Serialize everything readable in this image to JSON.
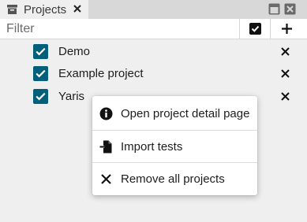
{
  "tab": {
    "icon": "archive-box-icon",
    "label": "Projects",
    "close_icon": "close-icon"
  },
  "window_controls": {
    "restore_icon": "window-restore-icon",
    "close_icon": "window-close-icon"
  },
  "toolbar": {
    "filter_value": "",
    "filter_placeholder": "Filter",
    "select_all_icon": "checkbox-checked-icon",
    "add_icon": "plus-icon"
  },
  "projects": [
    {
      "label": "Demo",
      "checked": true
    },
    {
      "label": "Example project",
      "checked": true
    },
    {
      "label": "Yaris",
      "checked": true
    }
  ],
  "context_menu": {
    "items": [
      {
        "label": "Open project detail page",
        "icon": "info-circle-icon"
      },
      {
        "label": "Import tests",
        "icon": "file-import-icon"
      },
      {
        "label": "Remove all projects",
        "icon": "close-icon"
      }
    ]
  },
  "colors": {
    "checkbox": "#005f7b",
    "background": "#efefef",
    "tabbar": "#d8d8d8"
  }
}
